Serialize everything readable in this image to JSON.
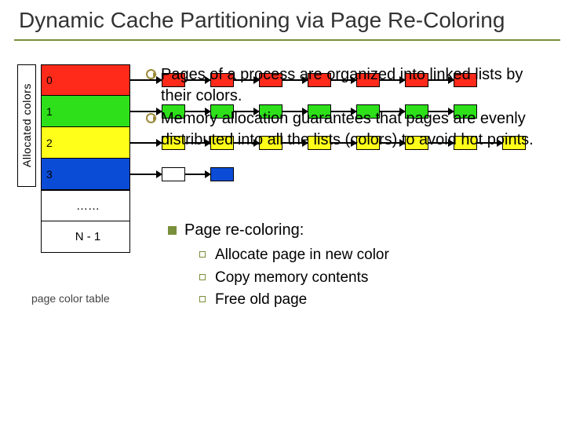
{
  "title": "Dynamic Cache Partitioning via Page Re-Coloring",
  "alloc_label": "Allocated colors",
  "rows": {
    "r0": "0",
    "r1": "1",
    "r2": "2",
    "r3": "3",
    "dots": "……",
    "last": "N - 1"
  },
  "pct_caption": "page color table",
  "bullets": {
    "b1": "Pages of a process are organized into linked lists by their colors.",
    "b2": "Memory allocation guarantees that pages are evenly distributed into all the lists (colors) to avoid hot points."
  },
  "recolor": {
    "head": "Page re-coloring:",
    "s1": "Allocate page in new color",
    "s2": "Copy memory contents",
    "s3": "Free old page"
  }
}
